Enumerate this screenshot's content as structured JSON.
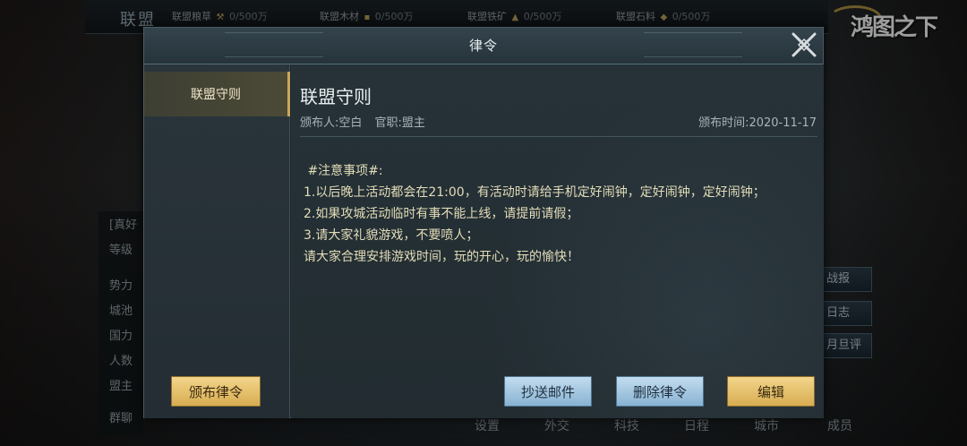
{
  "background": {
    "alliance_title": "联盟",
    "resources": [
      {
        "label": "联盟粮草",
        "value": "0/500万"
      },
      {
        "label": "联盟木材",
        "value": "0/500万"
      },
      {
        "label": "联盟铁矿",
        "value": "0/500万"
      },
      {
        "label": "联盟石料",
        "value": "0/500万"
      }
    ],
    "logo_text": "鸿图之下",
    "left_rows": [
      "[真好",
      "等级",
      "势力",
      "城池",
      "国力",
      "人数",
      "盟主",
      "群聊"
    ],
    "right_buttons": [
      "战报",
      "日志",
      "月旦评"
    ],
    "bottom_tabs": [
      "设置",
      "外交",
      "科技",
      "日程",
      "城市",
      "成员"
    ]
  },
  "modal": {
    "title": "律令",
    "sidebar": {
      "items": [
        {
          "label": "联盟守则",
          "selected": true
        }
      ]
    },
    "content": {
      "title": "联盟守则",
      "publisher": "颁布人:空白",
      "position": "官职:盟主",
      "publish_time": "颁布时间:2020-11-17",
      "body": " #注意事项#:\n1.以后晚上活动都会在21:00，有活动时请给手机定好闹钟，定好闹钟，定好闹钟；\n2.如果攻城活动临时有事不能上线，请提前请假；\n3.请大家礼貌游戏，不要喷人；\n请大家合理安排游戏时间，玩的开心，玩的愉快！"
    },
    "buttons": {
      "publish": "颁布律令",
      "cc_mail": "抄送邮件",
      "delete": "删除律令",
      "edit": "编辑"
    },
    "accent_gold": "#d7ad52",
    "accent_blue": "#88b3d3"
  }
}
